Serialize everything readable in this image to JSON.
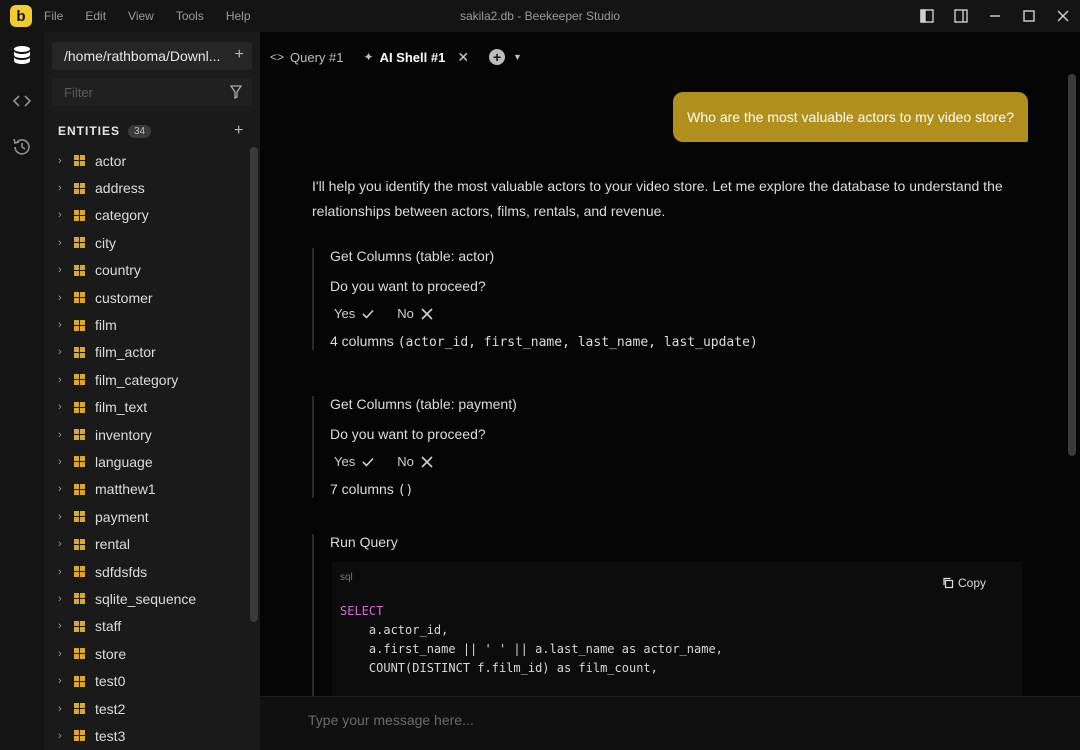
{
  "app": {
    "logo_letter": "b",
    "window_title": "sakila2.db - Beekeeper Studio",
    "menu": [
      "File",
      "Edit",
      "View",
      "Tools",
      "Help"
    ]
  },
  "sidebar": {
    "connection": "/home/rathboma/Downl...",
    "filter_placeholder": "Filter",
    "entities_label": "ENTITIES",
    "entities_count": "34",
    "tables": [
      "actor",
      "address",
      "category",
      "city",
      "country",
      "customer",
      "film",
      "film_actor",
      "film_category",
      "film_text",
      "inventory",
      "language",
      "matthew1",
      "payment",
      "rental",
      "sdfdsfds",
      "sqlite_sequence",
      "staff",
      "store",
      "test0",
      "test2",
      "test3"
    ]
  },
  "tabs": [
    {
      "label": "Query #1",
      "icon": "code-icon"
    },
    {
      "label": "AI Shell #1",
      "icon": "sparkle-icon"
    }
  ],
  "chat": {
    "user_message": "Who are the most valuable actors to my video store?",
    "assistant_intro": "I'll help you identify the most valuable actors to your video store. Let me explore the database to understand the relationships between actors, films, rentals, and revenue.",
    "tools": [
      {
        "title": "Get Columns (table: actor)",
        "question": "Do you want to proceed?",
        "yes": "Yes",
        "no": "No",
        "result_prefix": "4 columns",
        "result_mono": "(actor_id, first_name, last_name, last_update)"
      },
      {
        "title": "Get Columns (table: payment)",
        "question": "Do you want to proceed?",
        "yes": "Yes",
        "no": "No",
        "result_prefix": "7 columns",
        "result_mono": "()"
      }
    ],
    "query": {
      "title": "Run Query",
      "lang": "sql",
      "copy_label": "Copy",
      "code_keyword": "SELECT",
      "code_lines": [
        "    a.actor_id,",
        "    a.first_name || ' ' || a.last_name as actor_name,",
        "    COUNT(DISTINCT f.film_id) as film_count,"
      ]
    },
    "input_placeholder": "Type your message here..."
  }
}
